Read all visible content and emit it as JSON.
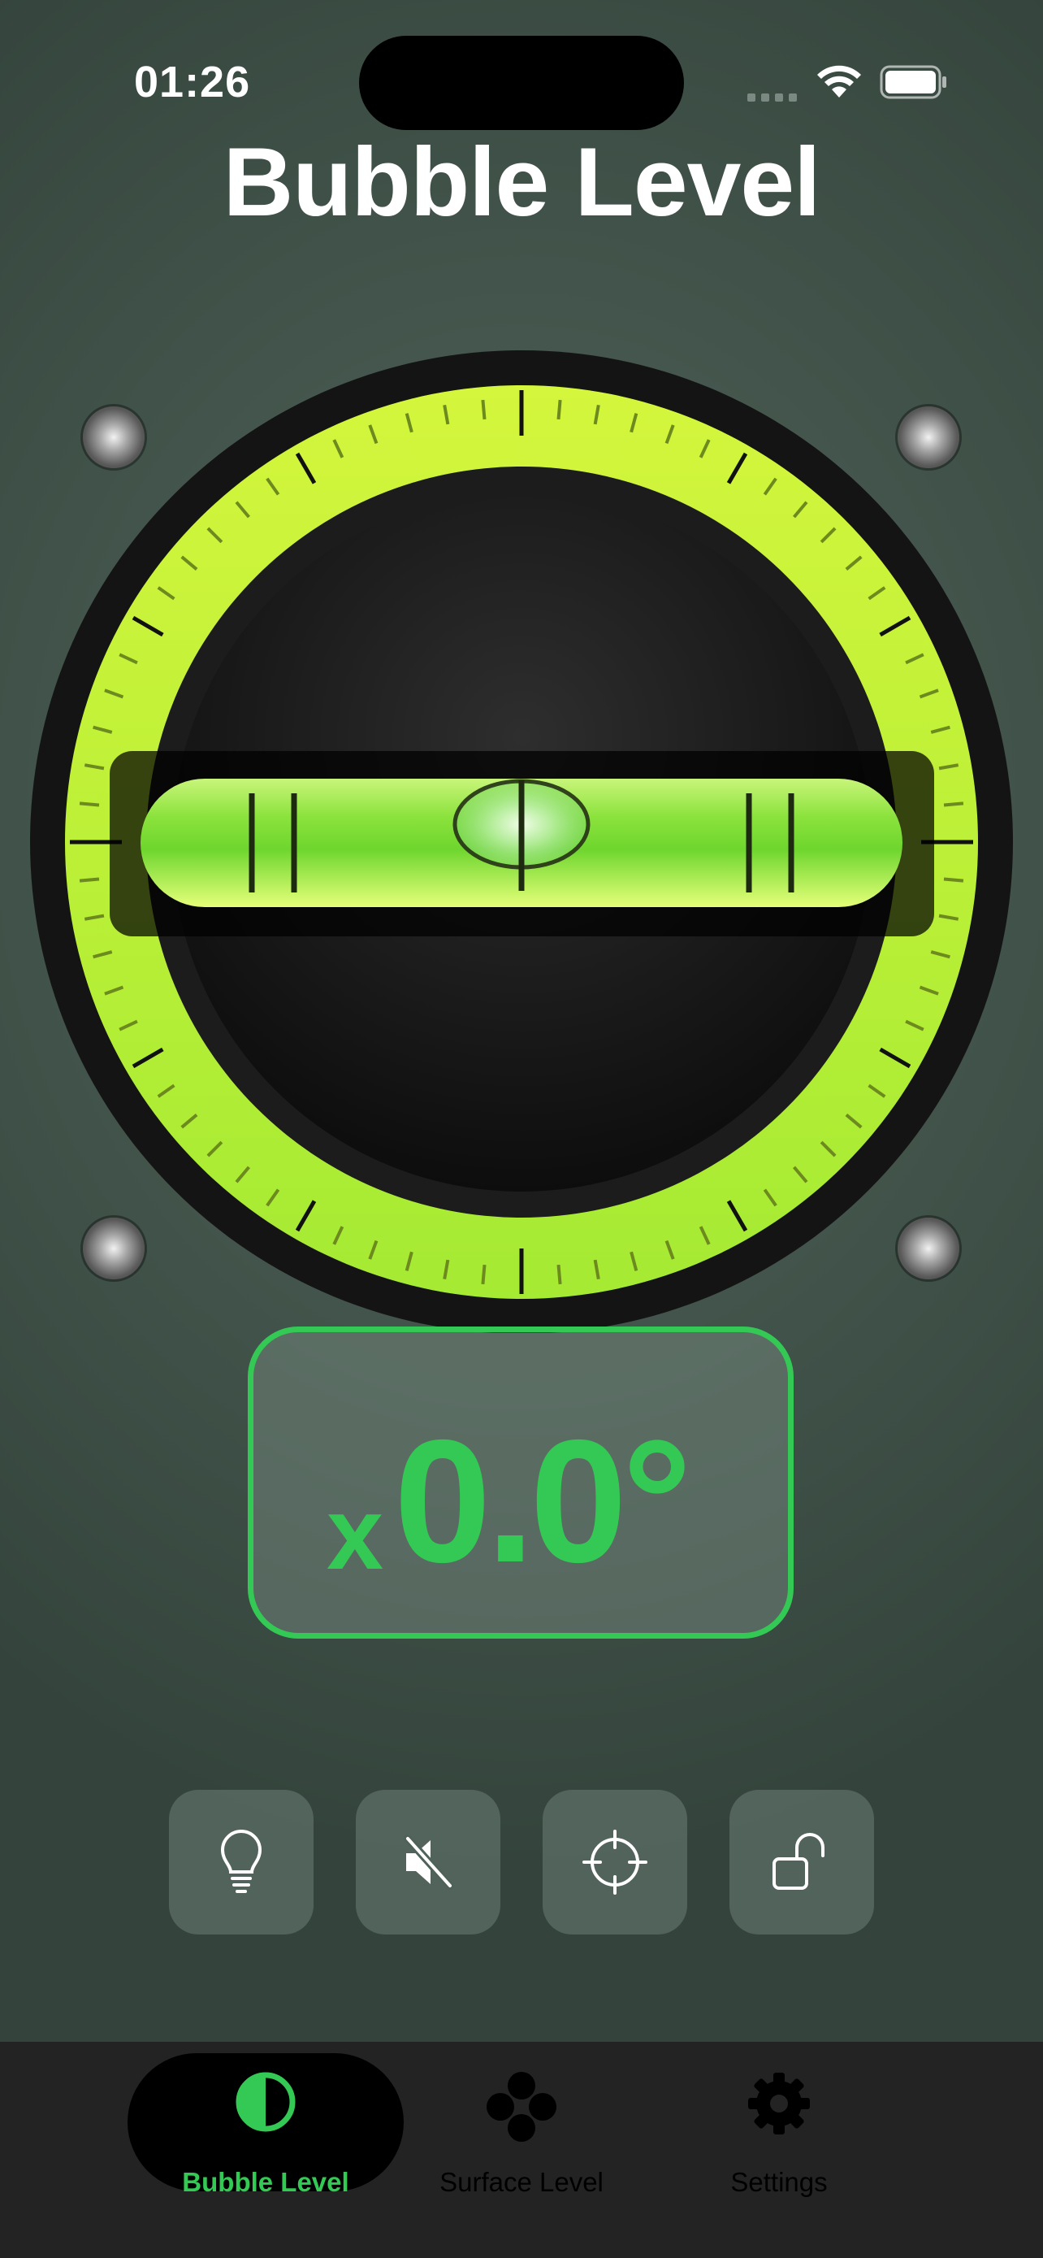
{
  "status_bar": {
    "time": "01:26"
  },
  "page": {
    "title": "Bubble Level"
  },
  "reading": {
    "axis": "x",
    "value": "0.0°"
  },
  "colors": {
    "accent": "#33c954",
    "ring": "#c6f03a",
    "vial": "#8ee640",
    "background": "#44564d",
    "tab_bar": "#232323"
  },
  "controls": [
    {
      "icon": "lightbulb-icon",
      "label": ""
    },
    {
      "icon": "speaker-muted-icon",
      "label": ""
    },
    {
      "icon": "crosshair-icon",
      "label": ""
    },
    {
      "icon": "unlock-icon",
      "label": ""
    }
  ],
  "tabs": [
    {
      "label": "Bubble Level",
      "icon": "half-circle-icon",
      "active": true
    },
    {
      "label": "Surface Level",
      "icon": "four-dots-icon",
      "active": false
    },
    {
      "label": "Settings",
      "icon": "gear-icon",
      "active": false
    }
  ],
  "level": {
    "tilt_degrees": 0.0
  }
}
